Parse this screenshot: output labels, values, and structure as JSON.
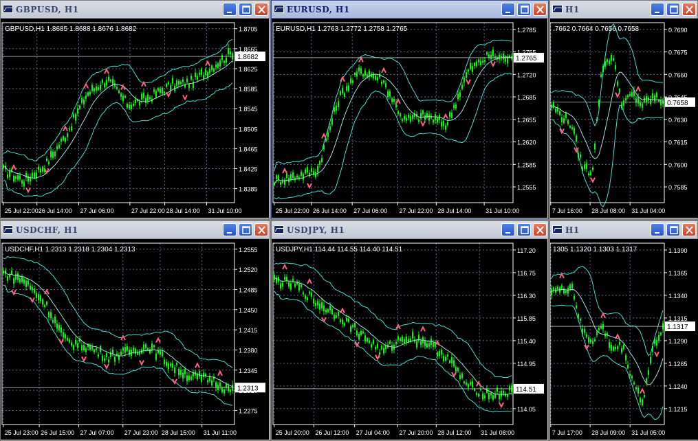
{
  "windows": [
    {
      "id": "gbpusd",
      "title": "GBPUSD, H1",
      "active": false,
      "header": "GBPUSD,H1  1.8685 1.8688 1.8676 1.8682",
      "price_label": "1.8682",
      "y_ticks": [
        "1.8705",
        "1.8665",
        "1.8625",
        "1.8585",
        "1.8545",
        "1.8505",
        "1.8465",
        "1.8425",
        "1.8385"
      ],
      "x_ticks": [
        "25 Jul 22:00",
        "26 Jul 14:00",
        "27 Jul 06:00",
        "27 Jul 22:00",
        "28 Jul 14:00",
        "31 Jul 10:00"
      ]
    },
    {
      "id": "eurusd",
      "title": "EURUSD, H1",
      "active": true,
      "header": "EURUSD,H1  1.2763 1.2772 1.2758 1.2765",
      "price_label": "1.2765",
      "y_ticks": [
        "1.2785",
        "1.2755",
        "1.2720",
        "1.2685",
        "1.2655",
        "1.2620",
        "1.2585",
        "1.2555"
      ],
      "x_ticks": [
        "25 Jul 22:00",
        "26 Jul 14:00",
        "27 Jul 06:00",
        "27 Jul 22:00",
        "28 Jul 14:00",
        "31 Jul 10:00"
      ]
    },
    {
      "id": "audusd",
      "title": "H1",
      "active": false,
      "header": ".7662 0.7664 0.7656 0.7658",
      "price_label": "0.7658",
      "y_ticks": [
        "0.7690",
        "0.7675",
        "0.7660",
        "0.7645",
        "0.7630",
        "0.7615",
        "0.7600",
        "0.7585"
      ],
      "x_ticks": [
        "7 Jul 16:00",
        "28 Jul 08:00",
        "31 Jul 04:00"
      ]
    },
    {
      "id": "usdchf",
      "title": "USDCHF, H1",
      "active": false,
      "header": "USDCHF,H1  1.2313 1.2318 1.2304 1.2313",
      "price_label": "1.2313",
      "y_ticks": [
        "1.2555",
        "1.2520",
        "1.2485",
        "1.2450",
        "1.2415",
        "1.2380",
        "1.2345",
        "1.2310",
        "1.2275"
      ],
      "x_ticks": [
        "25 Jul 23:00",
        "26 Jul 15:00",
        "27 Jul 07:00",
        "27 Jul 23:00",
        "28 Jul 15:00",
        "31 Jul 11:00"
      ]
    },
    {
      "id": "usdjpy",
      "title": "USDJPY, H1",
      "active": false,
      "header": "USDJPY,H1  114.44 114.55 114.40 114.51",
      "price_label": "114.51",
      "y_ticks": [
        "117.20",
        "116.75",
        "116.30",
        "115.85",
        "115.40",
        "114.95",
        "114.50",
        "114.05"
      ],
      "x_ticks": [
        "25 Jul 20:00",
        "26 Jul 12:00",
        "27 Jul 04:00",
        "27 Jul 20:00",
        "28 Jul 12:00",
        "31 Jul 08:00"
      ]
    },
    {
      "id": "usdcad",
      "title": "H1",
      "active": false,
      "header": "1305 1.1320 1.1303 1.1317",
      "price_label": "1.1317",
      "y_ticks": [
        "1.1390",
        "1.1365",
        "1.1340",
        "1.1315",
        "1.1290",
        "1.1265",
        "1.1240",
        "1.1215"
      ],
      "x_ticks": [
        "7 Jul 17:00",
        "28 Jul 09:00",
        "31 Jul 05:00"
      ]
    }
  ],
  "colors": {
    "chart_bg": "#000000",
    "candles": "#00ff00",
    "bands": "#40e0d0",
    "fractals": "#ff6080",
    "grid": "#5a6a8a",
    "text": "#ffffff"
  }
}
